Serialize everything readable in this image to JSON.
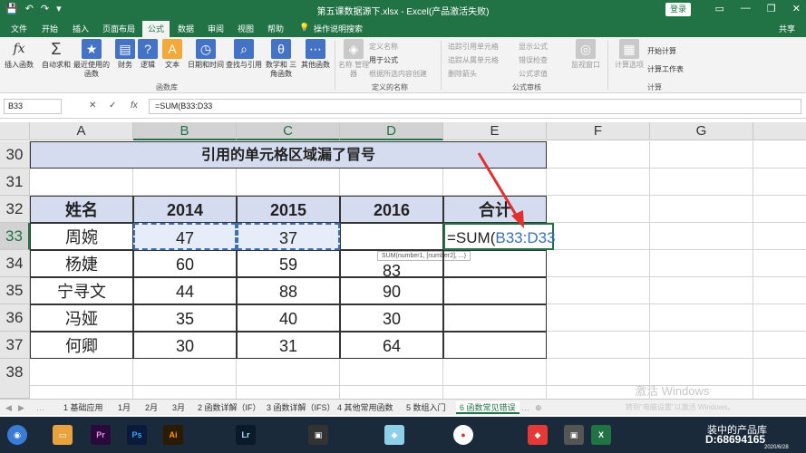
{
  "titlebar": {
    "title": "第五课数据源下.xlsx - Excel(产品激活失败)",
    "login": "登录"
  },
  "tabs": {
    "items": [
      "文件",
      "开始",
      "插入",
      "页面布局",
      "公式",
      "数据",
      "审阅",
      "视图",
      "帮助"
    ],
    "active": "公式",
    "tellme": "操作说明搜索",
    "share": "共享"
  },
  "ribbon": {
    "insert_function": "插入函数",
    "autosum": "自动求和",
    "recent": "最近使用的 函数",
    "financial": "财务",
    "logical": "逻辑",
    "text": "文本",
    "datetime": "日期和时间",
    "lookup": "查找与引用",
    "math": "数学和 三角函数",
    "more": "其他函数",
    "group_library": "函数库",
    "name_manager": "名称 管理器",
    "define_name": "定义名称",
    "use_in_formula": "用于公式",
    "create_from_selection": "根据所选内容创建",
    "group_names": "定义的名称",
    "trace_precedents": "追踪引用单元格",
    "trace_dependents": "追踪从属单元格",
    "remove_arrows": "删除箭头",
    "show_formulas": "显示公式",
    "error_check": "错误检查",
    "evaluate": "公式求值",
    "watch_window": "监视窗口",
    "group_audit": "公式审核",
    "calc_options": "计算选项",
    "calc_now": "开始计算",
    "calc_sheet": "计算工作表",
    "group_calc": "计算"
  },
  "formula_bar": {
    "name_box": "B33",
    "formula": "=SUM(B33:D33"
  },
  "columns": [
    "A",
    "B",
    "C",
    "D",
    "E",
    "F",
    "G"
  ],
  "rows": [
    "30",
    "31",
    "32",
    "33",
    "34",
    "35",
    "36",
    "37",
    "38"
  ],
  "table": {
    "title": "引用的单元格区域漏了冒号",
    "headers": [
      "姓名",
      "2014",
      "2015",
      "2016",
      "合计"
    ],
    "data": [
      [
        "周婉",
        "47",
        "37",
        ""
      ],
      [
        "杨婕",
        "60",
        "59",
        "83"
      ],
      [
        "宁寻文",
        "44",
        "88",
        "90"
      ],
      [
        "冯娅",
        "35",
        "40",
        "30"
      ],
      [
        "何卿",
        "30",
        "31",
        "64"
      ]
    ],
    "edit_formula_prefix": "=SUM(",
    "edit_formula_ref": "B33:D33",
    "tooltip": "SUM(number1, [number2], ...)"
  },
  "sheets": [
    "1 基础应用",
    "1月",
    "2月",
    "3月",
    "2 函数详解（IF）",
    "3 函数详解（IFS）",
    "4 其他常用函数",
    "5 数组入门",
    "6 函数常见错误"
  ],
  "active_sheet": "6 函数常见错误",
  "watermark": {
    "line1": "激活 Windows",
    "line2": "转到\"电脑设置\"以激活 Windows。"
  },
  "taskbar": {
    "apps": [
      "Pr",
      "Ps",
      "Ai",
      "Lr",
      "X"
    ],
    "time": "D:68694165",
    "date": "2020/6/28",
    "brand": "装中的产品库"
  },
  "colors": {
    "excel_green": "#217346",
    "header_fill": "#d6dcf0",
    "arrow": "#e03030"
  }
}
